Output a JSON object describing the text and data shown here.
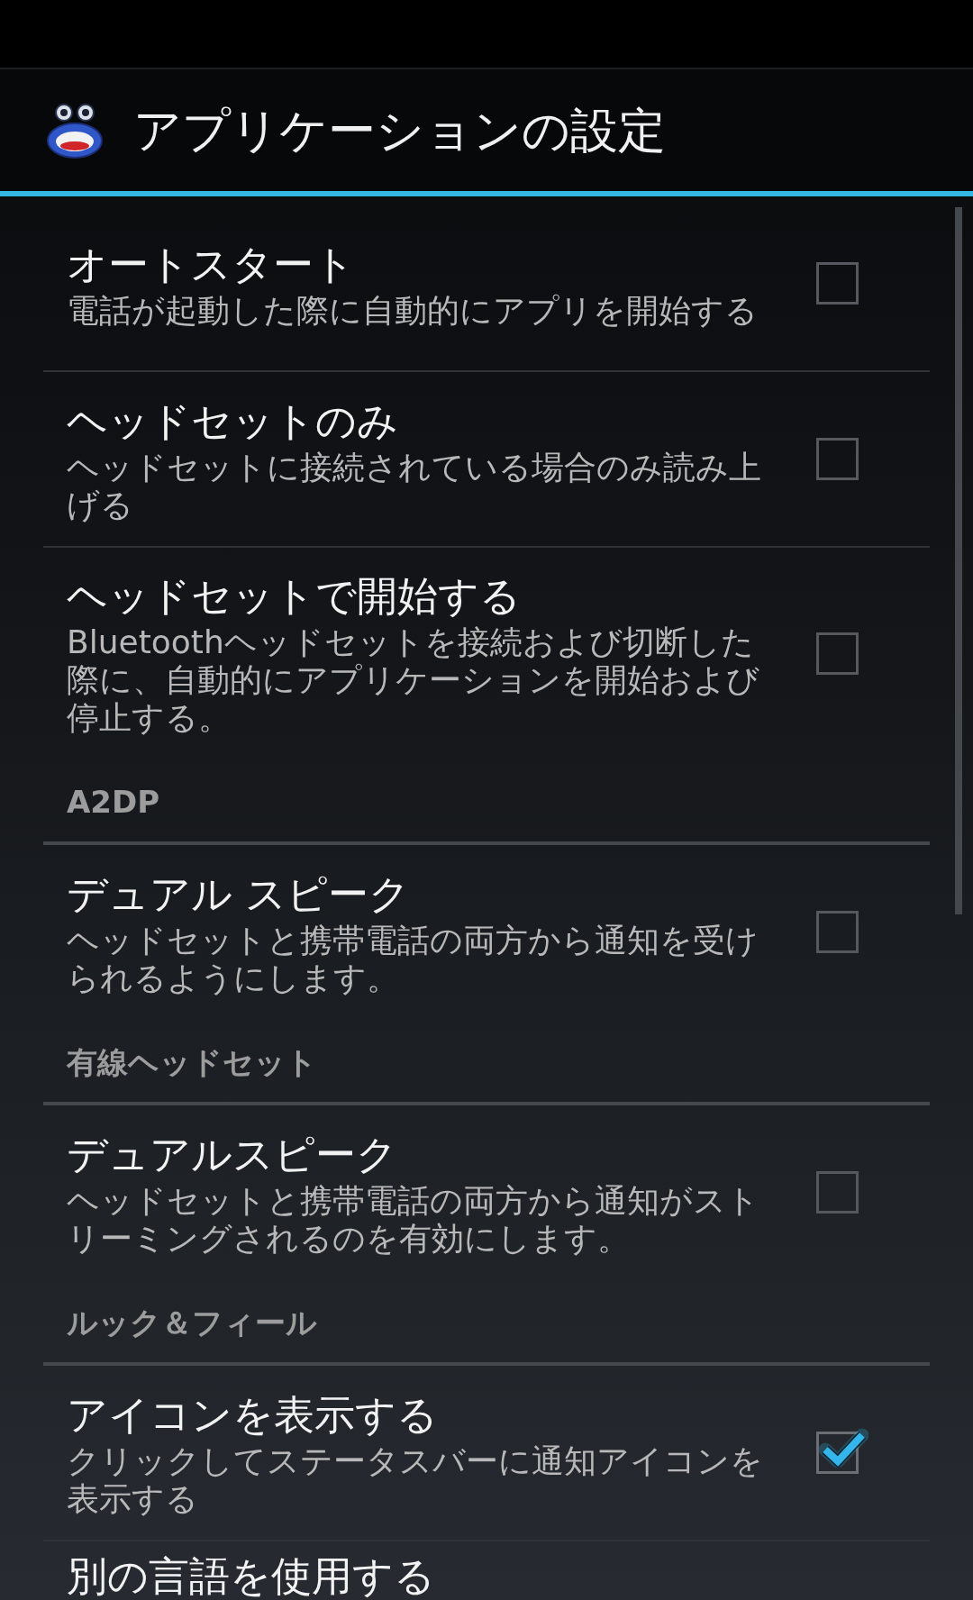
{
  "action_bar": {
    "title": "アプリケーションの設定"
  },
  "preferences": [
    {
      "kind": "checkbox",
      "title": "オートスタート",
      "summary": "電話が起動した際に自動的にアプリを開始する",
      "checked": false
    },
    {
      "kind": "checkbox",
      "title": "ヘッドセットのみ",
      "summary": "ヘッドセットに接続されている場合のみ読み上げる",
      "checked": false
    },
    {
      "kind": "checkbox",
      "title": "ヘッドセットで開始する",
      "summary": "Bluetoothヘッドセットを接続および切断した際に、自動的にアプリケーションを開始および停止する。",
      "checked": false
    },
    {
      "kind": "category",
      "title": "A2DP"
    },
    {
      "kind": "checkbox",
      "title": "デュアル スピーク",
      "summary": "ヘッドセットと携帯電話の両方から通知を受けられるようにします。",
      "checked": false
    },
    {
      "kind": "category",
      "title": "有線ヘッドセット"
    },
    {
      "kind": "checkbox",
      "title": "デュアルスピーク",
      "summary": "ヘッドセットと携帯電話の両方から通知がストリーミングされるのを有効にします。",
      "checked": false
    },
    {
      "kind": "category",
      "title": "ルック＆フィール"
    },
    {
      "kind": "checkbox",
      "title": "アイコンを表示する",
      "summary": "クリックしてステータスバーに通知アイコンを表示する",
      "checked": true
    },
    {
      "kind": "checkbox",
      "title": "別の言語を使用する"
    }
  ]
}
